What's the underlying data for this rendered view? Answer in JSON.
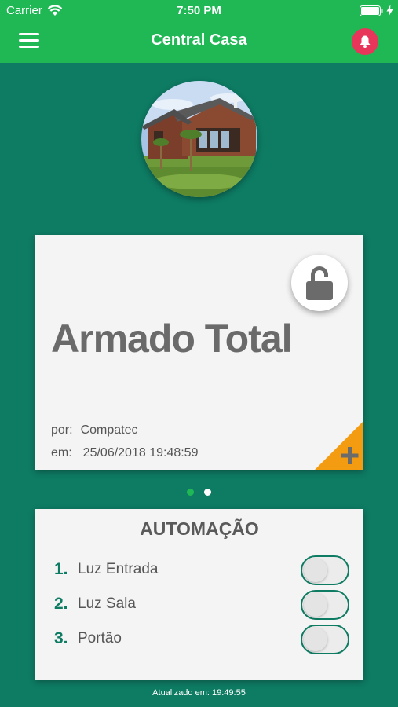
{
  "status_bar": {
    "carrier": "Carrier",
    "time": "7:50 PM"
  },
  "nav": {
    "title": "Central Casa",
    "menu_icon": "hamburger-icon",
    "bell_icon": "bell-icon"
  },
  "status_card": {
    "title": "Armado Total",
    "by_label": "por:",
    "by_value": "Compatec",
    "at_label": "em:",
    "at_value": "25/06/2018 19:48:59",
    "lock_icon": "unlocked-padlock-icon",
    "corner_icon": "plus-icon"
  },
  "pager": {
    "count": 2,
    "active": 1
  },
  "automation": {
    "title": "AUTOMAÇÃO",
    "items": [
      {
        "number": "1.",
        "label": "Luz Entrada",
        "on": false
      },
      {
        "number": "2.",
        "label": "Luz Sala",
        "on": false
      },
      {
        "number": "3.",
        "label": "Portão",
        "on": false
      }
    ]
  },
  "footer": {
    "updated": "Atualizado em: 19:49:55"
  },
  "colors": {
    "background": "#0e7b63",
    "header": "#1fb855",
    "bell": "#e8365a",
    "corner": "#f39c12",
    "card": "#f4f4f4"
  }
}
